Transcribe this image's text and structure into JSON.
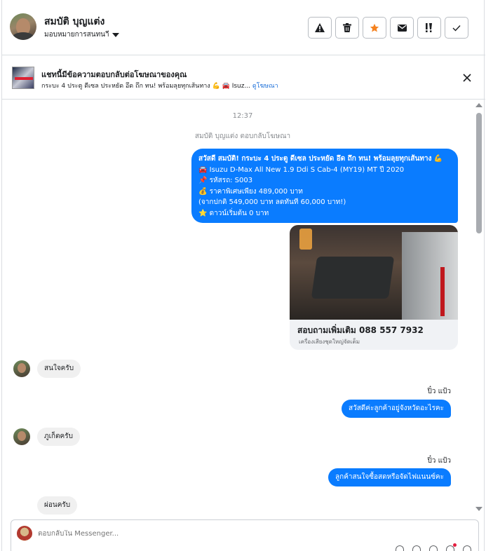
{
  "header": {
    "contact_name": "สมบัติ บุญแต่ง",
    "assign_label": "มอบหมายการสนทนาี",
    "tools": [
      {
        "icon": "warning-icon"
      },
      {
        "icon": "trash-icon"
      },
      {
        "icon": "star-icon"
      },
      {
        "icon": "envelope-icon"
      },
      {
        "icon": "priority-icon"
      },
      {
        "icon": "check-icon"
      }
    ],
    "star_color": "#f5821f"
  },
  "ad_banner": {
    "title": "แชทนี้มีข้อความตอบกลับต่อโฆษณาของคุณ",
    "subtitle": "กระบะ 4 ประตู ดีเซล ประหยัด อึด ถึก ทน! พร้อมลุยทุกเส้นทาง 💪 🚘 Isuz...",
    "link": "ดูโฆษณา"
  },
  "thread": {
    "time": "12:37",
    "reply_note": "สมบัติ บุญแต่ง ตอบกลับโฆษณา",
    "ad_message_lines": [
      "สวัสดี สมบัติ! กระบะ 4 ประตู ดีเซล ประหยัด อึด ถึก ทน! พร้อมลุยทุกเส้นทาง 💪",
      "🚘 Isuzu D-Max All New 1.9 Ddi S Cab-4 (MY19) MT ปี 2020",
      "📌 รหัสรถ: S003",
      "💰 ราคาพิเศษเพียง 489,000 บาท",
      "(จากปกติ 549,000 บาท ลดทันที 60,000 บาท!)",
      "⭐ ดาวน์เริ่มต้น 0 บาท"
    ],
    "card": {
      "title": "สอบถามเพิ่มเติม 088 557 7932",
      "subtitle": "เครื่องเสียงชุดใหญ่จัดเต็ม"
    },
    "in_1": "สนใจครับ",
    "sender_1": "ปิ๋ว แป้ว",
    "out_1": "สวัสดีค่ะลูกค้าอยู่จังหวัดอะไรคะ",
    "in_2": "ภูเก็ตครับ",
    "sender_2": "ปิ๋ว แป้ว",
    "out_2": "ลูกค้าสนใจซื้อสดหรือจัดไฟแนนซ์คะ",
    "in_3": "ผ่อนครับ",
    "accent_color": "#0a7cff"
  },
  "composer": {
    "placeholder": "ตอบกลับใน Messenger..."
  }
}
